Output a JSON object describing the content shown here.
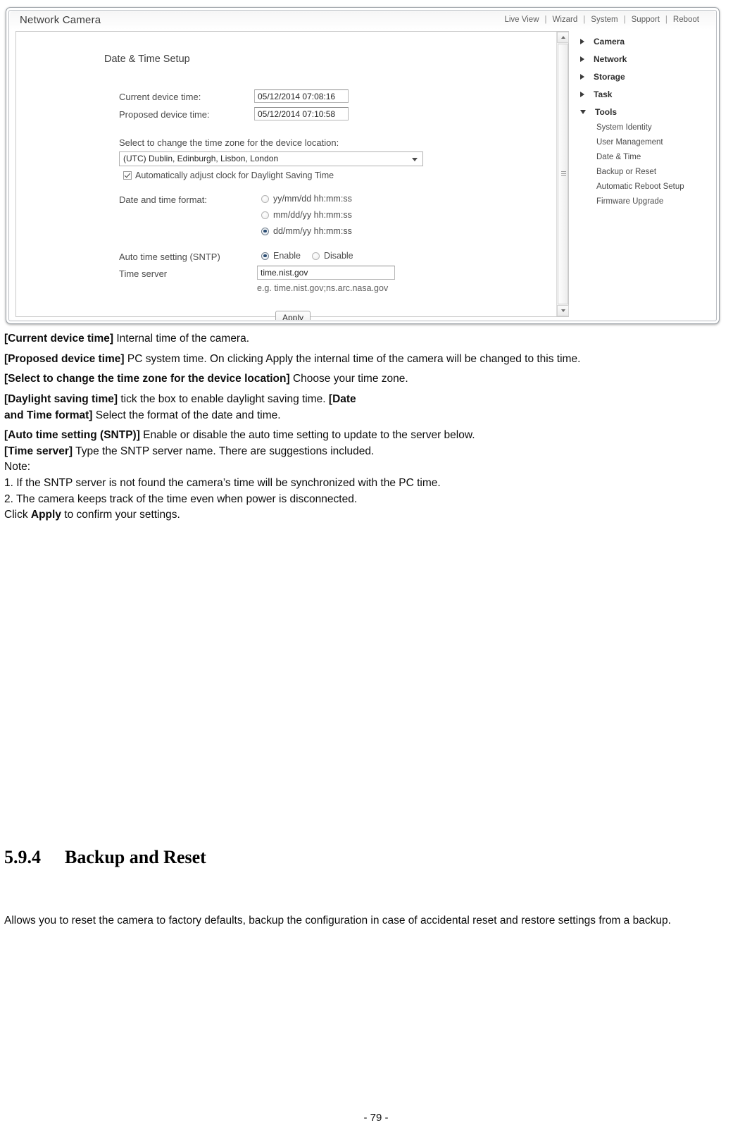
{
  "camera_ui": {
    "title": "Network Camera",
    "top_nav": [
      "Live View",
      "Wizard",
      "System",
      "Support",
      "Reboot"
    ],
    "nav_separator": "|",
    "form": {
      "heading": "Date & Time Setup",
      "current_time_label": "Current device time:",
      "current_time_value": "05/12/2014 07:08:16",
      "proposed_time_label": "Proposed device time:",
      "proposed_time_value": "05/12/2014 07:10:58",
      "timezone_label": "Select to change the time zone for the device location:",
      "timezone_value": "(UTC) Dublin, Edinburgh, Lisbon, London",
      "dst_label": "Automatically adjust clock for Daylight Saving Time",
      "dst_checked": true,
      "format_label": "Date and time format:",
      "format_options": [
        {
          "label": "yy/mm/dd hh:mm:ss",
          "selected": false
        },
        {
          "label": "mm/dd/yy hh:mm:ss",
          "selected": false
        },
        {
          "label": "dd/mm/yy hh:mm:ss",
          "selected": true
        }
      ],
      "sntp_label": "Auto time setting (SNTP)",
      "sntp_enable_label": "Enable",
      "sntp_disable_label": "Disable",
      "sntp_enabled": true,
      "time_server_label": "Time server",
      "time_server_value": "time.nist.gov",
      "time_server_hint": "e.g. time.nist.gov;ns.arc.nasa.gov",
      "apply_label": "Apply"
    },
    "side_nav": [
      {
        "label": "Camera",
        "expanded": false,
        "children": []
      },
      {
        "label": "Network",
        "expanded": false,
        "children": []
      },
      {
        "label": "Storage",
        "expanded": false,
        "children": []
      },
      {
        "label": "Task",
        "expanded": false,
        "children": []
      },
      {
        "label": "Tools",
        "expanded": true,
        "children": [
          "System Identity",
          "User Management",
          "Date & Time",
          "Backup or Reset",
          "Automatic Reboot Setup",
          "Firmware Upgrade"
        ]
      }
    ]
  },
  "doc": {
    "paragraphs": [
      {
        "term": "[Current device time]",
        "text": " Internal time of the camera."
      },
      {
        "term": "[Proposed device time]",
        "text": " PC system time. On clicking Apply the internal time of the camera will be changed to this time."
      },
      {
        "term": "[Select to change the time zone for the device location]",
        "text": " Choose your time zone."
      }
    ],
    "dst_line_a_bold": "[Daylight saving time]",
    "dst_line_a_text": " tick the box to enable daylight saving time. ",
    "dst_line_a_bold2": "[Date",
    "dst_line_b_bold": "and Time format]",
    "dst_line_b_text": " Select the format of the date and time.",
    "sntp_bold": "[Auto time setting (SNTP)]",
    "sntp_text": " Enable or disable the auto time setting to update to the server below.",
    "timeserver_bold": "[Time server]",
    "timeserver_text": " Type the SNTP server name. There are suggestions included.",
    "note_label": "Note:",
    "note_1": "1. If the SNTP server is not found the camera’s time will be synchronized with the PC time.",
    "note_2": "2. The camera keeps track of the time even when power is disconnected.",
    "click_prefix": "Click ",
    "click_bold": "Apply",
    "click_suffix": " to confirm your settings."
  },
  "section": {
    "number": "5.9.4",
    "title": "Backup and Reset",
    "body": "Allows you to reset the camera to factory defaults, backup the configuration in case of accidental reset and restore settings from a backup."
  },
  "footer": {
    "page_number": "- 79 -"
  }
}
